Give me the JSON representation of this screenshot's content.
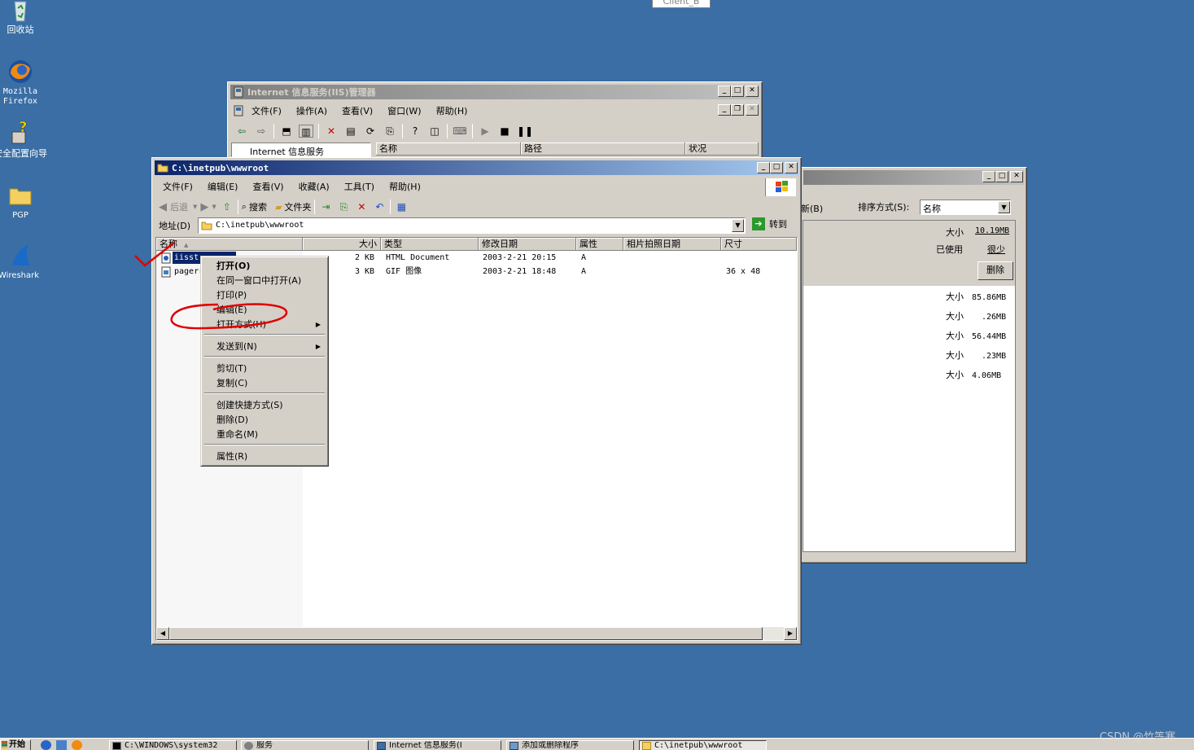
{
  "desktop": {
    "icons": [
      {
        "label": "回收站"
      },
      {
        "label": "Mozilla Firefox"
      },
      {
        "label": "安全配置向导"
      },
      {
        "label": "PGP"
      },
      {
        "label": "Wireshark"
      }
    ],
    "tooltip": "Client_B"
  },
  "iis_window": {
    "title": "Internet 信息服务(IIS)管理器",
    "menu": [
      "文件(F)",
      "操作(A)",
      "查看(V)",
      "窗口(W)",
      "帮助(H)"
    ],
    "tree_root": "Internet 信息服务",
    "columns": [
      "名称",
      "路径",
      "状况"
    ]
  },
  "disk_window": {
    "refresh_label": "新(B)",
    "sort_label": "排序方式(S):",
    "sort_value": "名称",
    "size_label": "大小",
    "size_value": "10.19MB",
    "used_label": "已使用",
    "used_value": "很少",
    "delete_button": "删除",
    "items": [
      {
        "label": "大小",
        "value": "85.86MB"
      },
      {
        "label": "大小",
        "value": ".26MB"
      },
      {
        "label": "大小",
        "value": "56.44MB"
      },
      {
        "label": "大小",
        "value": ".23MB"
      },
      {
        "label": "大小",
        "value": "4.06MB"
      }
    ]
  },
  "explorer": {
    "title": "C:\\inetpub\\wwwroot",
    "menu": [
      "文件(F)",
      "编辑(E)",
      "查看(V)",
      "收藏(A)",
      "工具(T)",
      "帮助(H)"
    ],
    "toolbar": {
      "back": "后退",
      "search": "搜索",
      "folders": "文件夹"
    },
    "address_label": "地址(D)",
    "address_value": "C:\\inetpub\\wwwroot",
    "go_label": "转到",
    "columns": [
      "名称",
      "大小",
      "类型",
      "修改日期",
      "属性",
      "相片拍照日期",
      "尺寸"
    ],
    "files": [
      {
        "name": "iisst",
        "size": "2 KB",
        "type": "HTML Document",
        "modified": "2003-2-21 20:15",
        "attr": "A",
        "taken": "",
        "dims": ""
      },
      {
        "name": "pagerr",
        "size": "3 KB",
        "type": "GIF 图像",
        "modified": "2003-2-21 18:48",
        "attr": "A",
        "taken": "",
        "dims": "36 x 48"
      }
    ]
  },
  "context_menu": {
    "items": [
      {
        "label": "打开(O)"
      },
      {
        "label": "在同一窗口中打开(A)"
      },
      {
        "label": "打印(P)"
      },
      {
        "label": "编辑(E)"
      },
      {
        "label": "打开方式(H)"
      },
      {
        "label": "发送到(N)"
      },
      {
        "label": "剪切(T)"
      },
      {
        "label": "复制(C)"
      },
      {
        "label": "创建快捷方式(S)"
      },
      {
        "label": "删除(D)"
      },
      {
        "label": "重命名(M)"
      },
      {
        "label": "属性(R)"
      }
    ]
  },
  "taskbar": {
    "start": "开始",
    "tasks": [
      {
        "label": "C:\\WINDOWS\\system32"
      },
      {
        "label": "服务"
      },
      {
        "label": "Internet 信息服务(I"
      },
      {
        "label": "添加或删除程序"
      },
      {
        "label": "C:\\inetpub\\wwwroot"
      }
    ]
  },
  "watermark": "CSDN @竹等寒",
  "colors": {
    "desktop": "#3a6ea5",
    "title_active": "#0a246a",
    "annotation": "#e00000"
  }
}
